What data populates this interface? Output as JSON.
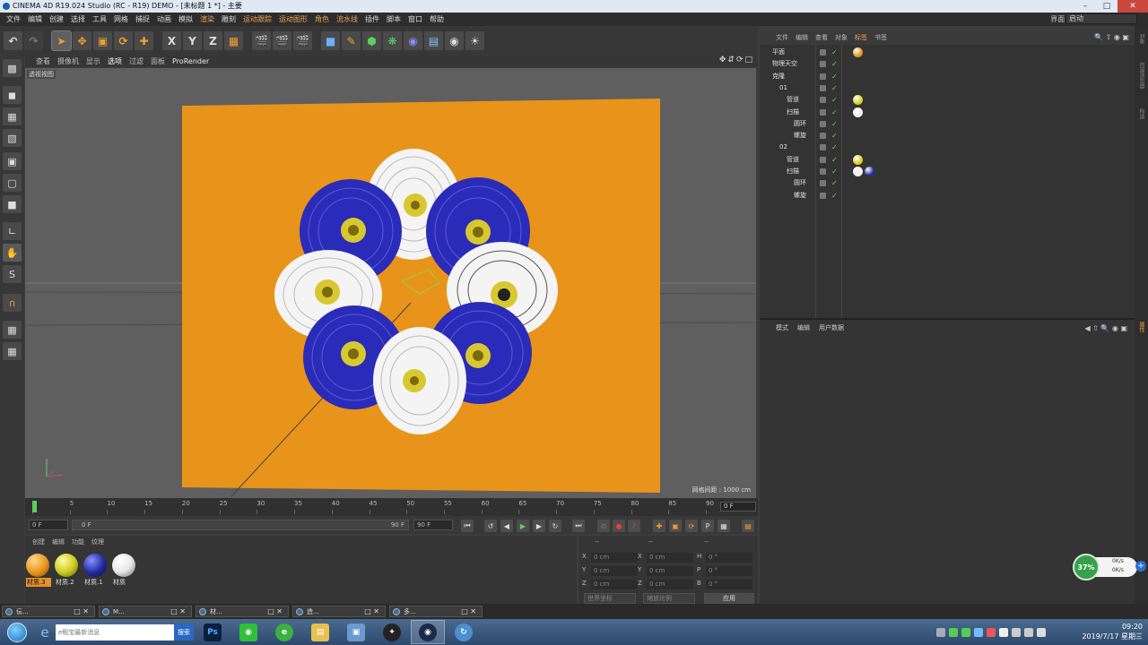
{
  "window": {
    "title": "CINEMA 4D R19.024 Studio (RC - R19) DEMO - [未标题 1 *] - 主要"
  },
  "menubar": {
    "items": [
      "文件",
      "编辑",
      "创建",
      "选择",
      "工具",
      "网格",
      "捕捉",
      "动画",
      "模拟",
      "渲染",
      "雕刻",
      "运动跟踪",
      "运动图形",
      "角色",
      "流水线",
      "插件",
      "脚本",
      "窗口",
      "帮助"
    ],
    "layout_label": "界面:",
    "layout_value": "启动"
  },
  "viewport": {
    "menu": [
      "查看",
      "摄像机",
      "显示",
      "选项",
      "过滤",
      "面板"
    ],
    "prorender": "ProRender",
    "label": "透视视图",
    "grid_spacing": "网格间距 : 1000 cm",
    "colors": {
      "background": "#5f5f5f",
      "plane": "#e8941a",
      "blue_disc": "#2a2bb8",
      "white_disc": "#f4f4f4",
      "hub": "#d8c830"
    }
  },
  "timeline": {
    "ticks": [
      "0",
      "5",
      "10",
      "15",
      "20",
      "25",
      "30",
      "35",
      "40",
      "45",
      "50",
      "55",
      "60",
      "65",
      "70",
      "75",
      "80",
      "85",
      "90"
    ],
    "end_field": "0 F",
    "current_frame": "0 F",
    "min_frame": "0 F",
    "slider_left": "0 F",
    "slider_right": "90 F",
    "max_frame": "90 F"
  },
  "materials": {
    "menu": [
      "创建",
      "编辑",
      "功能",
      "纹理"
    ],
    "items": [
      {
        "label": "材质.3",
        "color": "#e8941a"
      },
      {
        "label": "材质.2",
        "color": "#c8c820"
      },
      {
        "label": "材质.1",
        "color": "#1e2aa0"
      },
      {
        "label": "材质",
        "color": "#e8e8e8"
      }
    ]
  },
  "coords": {
    "headers": [
      "--",
      "--",
      "--"
    ],
    "rows": [
      {
        "a": "X",
        "v1": "0 cm",
        "b": "X",
        "v2": "0 cm",
        "c": "H",
        "v3": "0 °"
      },
      {
        "a": "Y",
        "v1": "0 cm",
        "b": "Y",
        "v2": "0 cm",
        "c": "P",
        "v3": "0 °"
      },
      {
        "a": "Z",
        "v1": "0 cm",
        "b": "Z",
        "v2": "0 cm",
        "c": "B",
        "v3": "0 °"
      }
    ],
    "mode1": "世界坐标",
    "mode2": "缩放比例",
    "apply": "应用"
  },
  "objects": {
    "menu": [
      "文件",
      "编辑",
      "查看",
      "对象",
      "标签",
      "书签"
    ],
    "rows": [
      {
        "name": "平面",
        "indent": 0,
        "tags": [
          "#e8941a"
        ]
      },
      {
        "name": "物理天空",
        "indent": 0,
        "tags": []
      },
      {
        "name": "克隆",
        "indent": 0,
        "tags": []
      },
      {
        "name": "01",
        "indent": 1,
        "tags": []
      },
      {
        "name": "管道",
        "indent": 2,
        "tags": [
          "#d8d020"
        ]
      },
      {
        "name": "扫描",
        "indent": 2,
        "tags": [
          "#eeeeee"
        ]
      },
      {
        "name": "圆环",
        "indent": 3,
        "tags": []
      },
      {
        "name": "螺旋",
        "indent": 3,
        "tags": []
      },
      {
        "name": "02",
        "indent": 1,
        "tags": []
      },
      {
        "name": "管道",
        "indent": 2,
        "tags": [
          "#d8d020"
        ]
      },
      {
        "name": "扫描",
        "indent": 2,
        "tags": [
          "#eeeeee",
          "#1e2aa0"
        ]
      },
      {
        "name": "圆环",
        "indent": 3,
        "tags": []
      },
      {
        "name": "螺旋",
        "indent": 3,
        "tags": []
      }
    ]
  },
  "attributes": {
    "menu": [
      "模式",
      "编辑",
      "用户数据"
    ]
  },
  "net_widget": {
    "percent": "37%",
    "up": "0K/s",
    "down": "0K/s"
  },
  "window_tabs": [
    {
      "label": "伝..."
    },
    {
      "label": "M..."
    },
    {
      "label": "材..."
    },
    {
      "label": "造..."
    },
    {
      "label": "多..."
    }
  ],
  "taskbar": {
    "search_placeholder": "e租宝最新消息",
    "search_button": "搜索",
    "time": "09:20",
    "date": "2019/7/17 星期三"
  }
}
